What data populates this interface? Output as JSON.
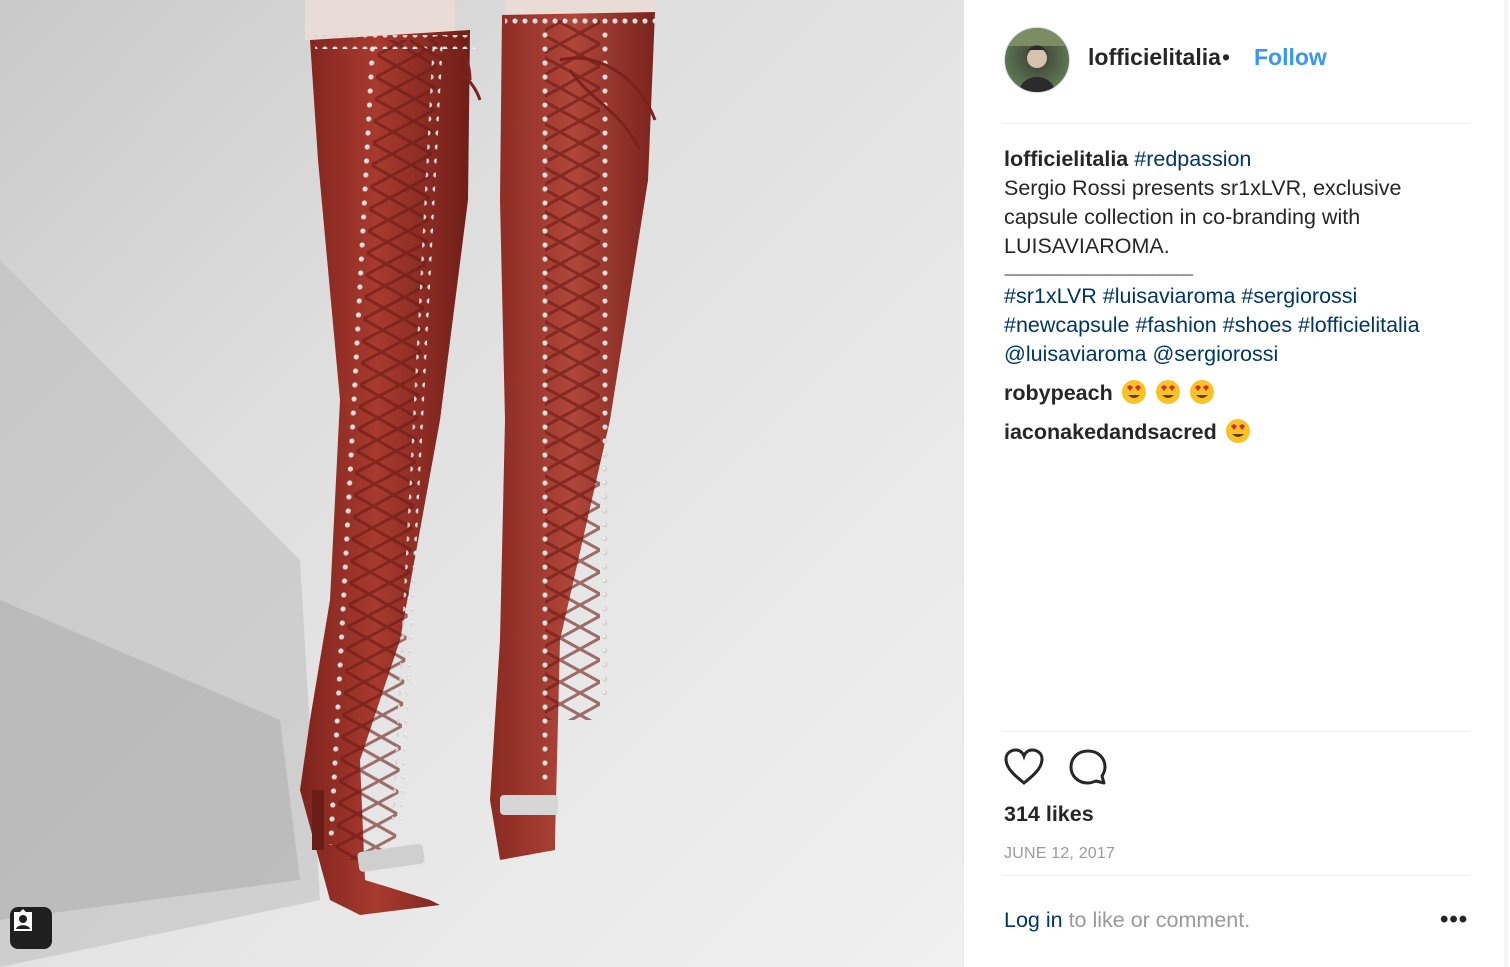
{
  "post": {
    "username": "lofficielitalia",
    "separator_dot": "•",
    "follow_label": "Follow",
    "caption": {
      "username": "lofficielitalia",
      "hashtag_first": "#redpassion",
      "text_line1": "Sergio Rossi presents sr1xLVR, exclusive",
      "text_line2": "capsule collection in co-branding with",
      "text_line3": "LUISAVIAROMA.",
      "separator": "---------------------------------------------------------------",
      "tags_line1": "#sr1xLVR #luisaviaroma #sergiorossi",
      "tags_line2": "#newcapsule #fashion #shoes #lofficielitalia",
      "mentions": "@luisaviaroma @sergiorossi"
    },
    "comments": [
      {
        "user": "robypeach",
        "emoji_count": 3
      },
      {
        "user": "iaconakedandsacred",
        "emoji_count": 1
      }
    ],
    "likes": "314 likes",
    "date": "JUNE 12, 2017",
    "login": {
      "link": "Log in",
      "rest": " to like or comment."
    },
    "more_label": "•••"
  },
  "icons": {
    "tag": "user-tag-icon",
    "heart": "heart-icon",
    "comment": "comment-icon",
    "emoji": "heart-eyes-emoji-icon"
  },
  "colors": {
    "follow": "#3897f0",
    "link": "#003569",
    "boot": "#9a2d24",
    "muted": "#999999"
  }
}
